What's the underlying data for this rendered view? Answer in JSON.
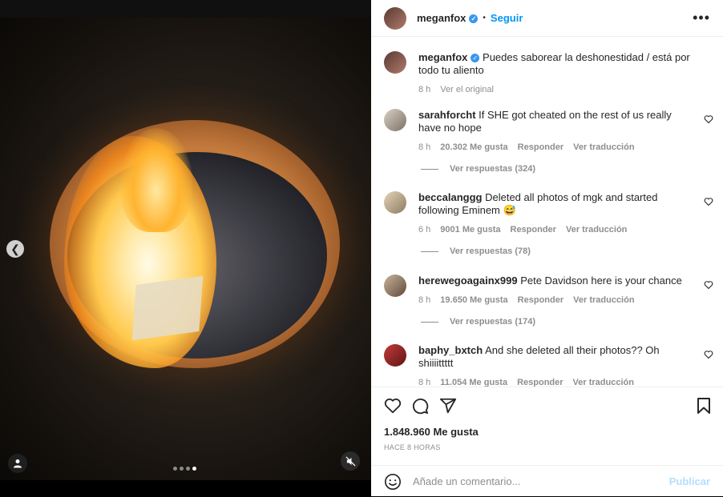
{
  "media": {
    "carousel_dots": 4,
    "active_dot": 4,
    "prev_icon": "chevron-left-icon",
    "user_tag_icon": "user-icon",
    "mute_icon": "muted-speaker-icon"
  },
  "header": {
    "username": "meganfox",
    "follow_label": "Seguir",
    "more_icon": "ellipsis-icon",
    "verified_icon": "verified-badge-icon"
  },
  "caption": {
    "username": "meganfox",
    "text": "Puedes saborear la deshonestidad / está por todo tu aliento",
    "time": "8 h",
    "see_original": "Ver el original"
  },
  "comments": [
    {
      "username": "sarahforcht",
      "text": "If SHE got cheated on the rest of us really have no hope",
      "time": "8 h",
      "likes": "20.302 Me gusta",
      "reply": "Responder",
      "translate": "Ver traducción",
      "replies": "Ver respuestas (324)"
    },
    {
      "username": "beccalanggg",
      "text": "Deleted all photos of mgk and started following Eminem 😅",
      "time": "6 h",
      "likes": "9001 Me gusta",
      "reply": "Responder",
      "translate": "Ver traducción",
      "replies": "Ver respuestas (78)"
    },
    {
      "username": "herewegoagainx999",
      "text": "Pete Davidson here is your chance",
      "time": "8 h",
      "likes": "19.650 Me gusta",
      "reply": "Responder",
      "translate": "Ver traducción",
      "replies": "Ver respuestas (174)"
    },
    {
      "username": "baphy_bxtch",
      "text": "And she deleted all their photos?? Oh shiiiittttt",
      "time": "8 h",
      "likes": "11.054 Me gusta",
      "reply": "Responder",
      "translate": "Ver traducción"
    }
  ],
  "actions": {
    "likes": "1.848.960 Me gusta",
    "time": "HACE 8 HORAS"
  },
  "composer": {
    "placeholder": "Añade un comentario...",
    "post_label": "Publicar",
    "emoji_icon": "smiley-icon"
  },
  "colors": {
    "accent": "#0095f6",
    "post_disabled": "#b2dffc",
    "muted": "#8e8e8e"
  }
}
